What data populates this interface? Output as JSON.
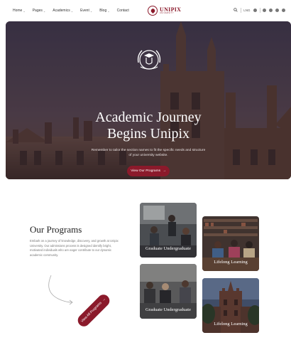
{
  "nav": {
    "items": [
      {
        "label": "Home",
        "has_dropdown": true
      },
      {
        "label": "Pages",
        "has_dropdown": true
      },
      {
        "label": "Academics",
        "has_dropdown": true
      },
      {
        "label": "Event",
        "has_dropdown": true
      },
      {
        "label": "Blog",
        "has_dropdown": true
      },
      {
        "label": "Contact",
        "has_dropdown": false
      }
    ],
    "language": "LNG",
    "icons": [
      "search-icon",
      "facebook-icon",
      "twitter-icon",
      "instagram-icon",
      "linkedin-icon"
    ]
  },
  "brand": {
    "name": "UNIPIX",
    "sub": "UNIVERSITY",
    "color": "#8b1a2b"
  },
  "hero": {
    "title_line1": "Academic Journey",
    "title_line2": "Begins Unipix",
    "description": "Remember to tailor the section names to fit the specific needs and structure of your university website.",
    "button_label": "View Our Programs"
  },
  "programs": {
    "title": "Our Programs",
    "description": "Embark on a journey of knowledge, discovery, and growth at Unipix University. Our admissions process is designed identify bright, motivated individuals who are eager contribute to our dynamic academic community.",
    "button_label": "View All Programs",
    "cards": [
      {
        "label": "Graduate Undergraduate"
      },
      {
        "label": "Lifelong Learning"
      },
      {
        "label": "Graduate Undergraduate"
      },
      {
        "label": "Lifelong Learning"
      }
    ]
  },
  "colors": {
    "accent": "#8b1a2b",
    "hero_overlay": "#4a3a40"
  }
}
